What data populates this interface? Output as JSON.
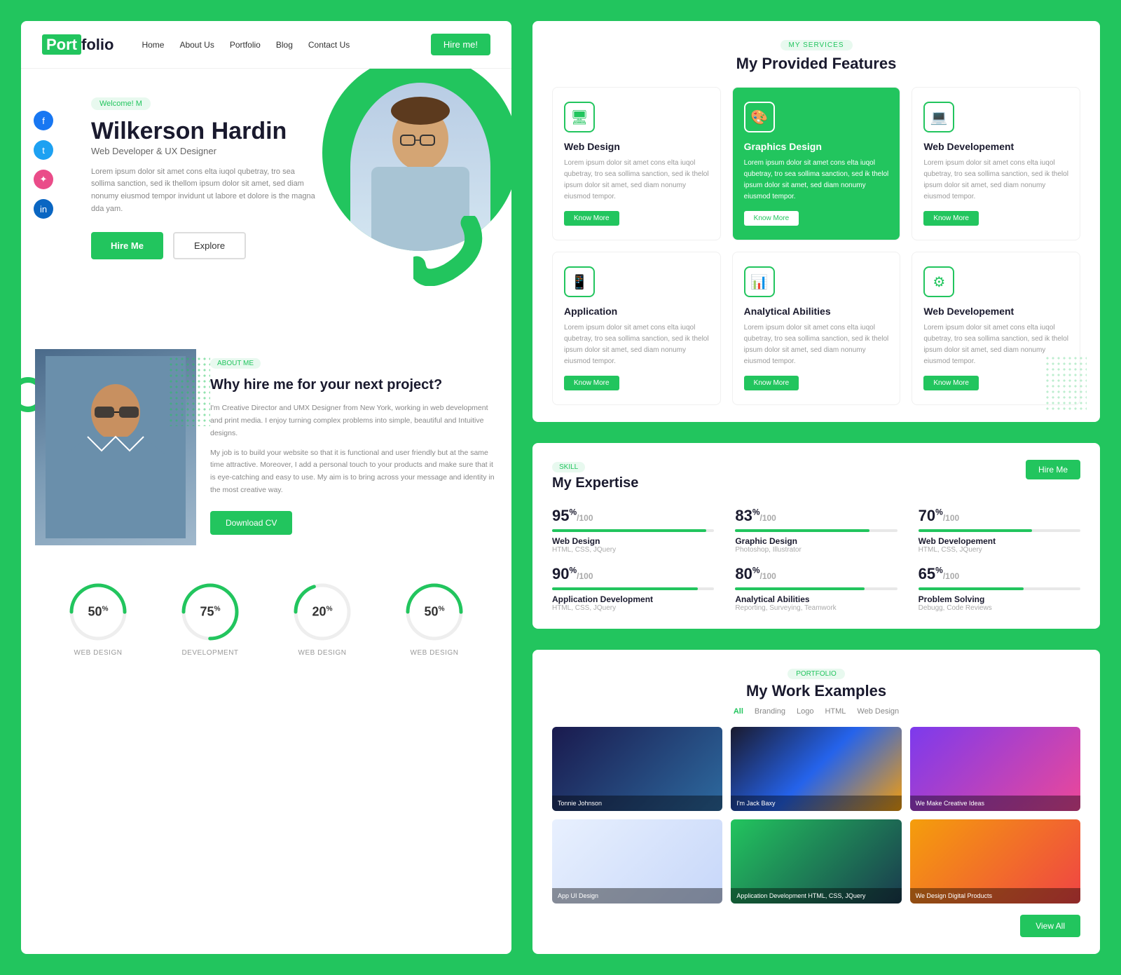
{
  "meta": {
    "bg_color": "#22c55e",
    "accent": "#22c55e"
  },
  "navbar": {
    "logo_part1": "Port",
    "logo_part2": "folio",
    "links": [
      "Home",
      "About Us",
      "Portfolio",
      "Blog",
      "Contact Us"
    ],
    "hire_btn": "Hire me!"
  },
  "hero": {
    "badge": "Welcome! M",
    "name": "Wilkerson Hardin",
    "title": "Web Developer & UX Designer",
    "description": "Lorem ipsum dolor sit amet cons elta iuqol qubetray, tro sea sollima sanction, sed ik thellom ipsum dolor sit amet, sed diam nonumy eiusmod tempor invidunt ut labore et dolore is the magna dda yam.",
    "btn_hire": "Hire Me",
    "btn_explore": "Explore"
  },
  "social": {
    "items": [
      {
        "name": "facebook-icon",
        "label": "f"
      },
      {
        "name": "twitter-icon",
        "label": "t"
      },
      {
        "name": "dribbble-icon",
        "label": "d"
      },
      {
        "name": "linkedin-icon",
        "label": "in"
      }
    ]
  },
  "about": {
    "badge": "ABOUT ME",
    "heading": "Why hire me for your next project?",
    "text1": "I'm Creative Director and UMX Designer from New York, working in web development and print media. I enjoy turning complex problems into simple, beautiful and Intuitive designs.",
    "text2": "My job is to build your website so that it is functional and user friendly but at the same time attractive. Moreover, I add a personal touch to your products and make sure that it is eye-catching and easy to use. My aim is to bring across your message and identity in the most creative way.",
    "btn_download": "Download CV"
  },
  "stats": [
    {
      "percent": "50",
      "label": "WEB DESIGN"
    },
    {
      "percent": "75",
      "label": "DEVELOPMENT"
    },
    {
      "percent": "20",
      "label": "WEB DESIGN"
    },
    {
      "percent": "50",
      "label": "WEB DESIGN"
    }
  ],
  "services": {
    "tag": "MY SERVICES",
    "title": "My Provided Features",
    "cards": [
      {
        "icon": "🖥",
        "name": "Web Design",
        "desc": "Lorem ipsum dolor sit amet cons elta iuqol qubetray, tro sea sollima sanction, sed ik thelol ipsum dolor sit amet, sed diam nonumy eiusmod tempor.",
        "btn": "Know More",
        "featured": false
      },
      {
        "icon": "🎨",
        "name": "Graphics Design",
        "desc": "Lorem ipsum dolor sit amet cons elta iuqol qubetray, tro sea sollima sanction, sed ik thelol ipsum dolor sit amet, sed diam nonumy eiusmod tempor.",
        "btn": "Know More",
        "featured": true
      },
      {
        "icon": "💻",
        "name": "Web Developement",
        "desc": "Lorem ipsum dolor sit amet cons elta iuqol qubetray, tro sea sollima sanction, sed ik thelol ipsum dolor sit amet, sed diam nonumy eiusmod tempor.",
        "btn": "Know More",
        "featured": false
      },
      {
        "icon": "📱",
        "name": "Application",
        "desc": "Lorem ipsum dolor sit amet cons elta iuqol qubetray, tro sea sollima sanction, sed ik thelol ipsum dolor sit amet, sed diam nonumy eiusmod tempor.",
        "btn": "Know More",
        "featured": false
      },
      {
        "icon": "📊",
        "name": "Analytical Abilities",
        "desc": "Lorem ipsum dolor sit amet cons elta iuqol qubetray, tro sea sollima sanction, sed ik thelol ipsum dolor sit amet, sed diam nonumy eiusmod tempor.",
        "btn": "Know More",
        "featured": false
      },
      {
        "icon": "⚙",
        "name": "Web Developement",
        "desc": "Lorem ipsum dolor sit amet cons elta iuqol qubetray, tro sea sollima sanction, sed ik thelol ipsum dolor sit amet, sed diam nonumy eiusmod tempor.",
        "btn": "Know More",
        "featured": false
      }
    ]
  },
  "skills": {
    "tag": "SKILL",
    "title": "My Expertise",
    "hire_btn": "Hire Me",
    "items": [
      {
        "percent": 95,
        "label": "Web Design",
        "tech": "HTML, CSS, JQuery"
      },
      {
        "percent": 83,
        "label": "Graphic Design",
        "tech": "Photoshop, Illustrator"
      },
      {
        "percent": 70,
        "label": "Web Developement",
        "tech": "HTML, CSS, JQuery"
      },
      {
        "percent": 90,
        "label": "Application Development",
        "tech": "HTML, CSS, JQuery"
      },
      {
        "percent": 80,
        "label": "Analytical Abilities",
        "tech": "Reporting, Surveying, Teamwork"
      },
      {
        "percent": 65,
        "label": "Problem Solving",
        "tech": "Debugg, Code Reviews"
      }
    ]
  },
  "portfolio": {
    "tag": "PORTFOLIO",
    "title": "My Work Examples",
    "filters": [
      "All",
      "Branding",
      "Logo",
      "HTML",
      "Web Design"
    ],
    "active_filter": "All",
    "items": [
      {
        "label": "Tonnie Johnson",
        "class": "p1"
      },
      {
        "label": "I'm Jack Baxy",
        "class": "p2"
      },
      {
        "label": "We Make Creative Ideas",
        "class": "p3"
      },
      {
        "label": "App UI Design",
        "class": "p4"
      },
      {
        "label": "Application Development\nHTML, CSS, JQuery",
        "class": "p5"
      },
      {
        "label": "We Design Digital Products",
        "class": "p6"
      }
    ],
    "view_all_btn": "View All"
  }
}
